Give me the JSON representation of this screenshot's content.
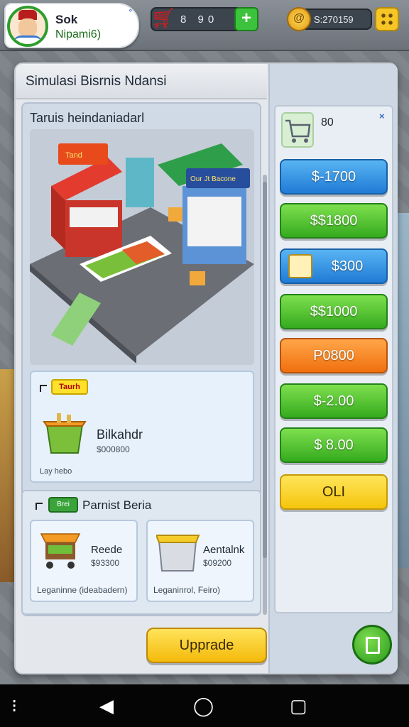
{
  "player": {
    "name": "Sok",
    "subtitle": "Nipami6)",
    "tag": "°"
  },
  "topbar": {
    "cart_value": "8  90",
    "coin_value": "S:270159",
    "coin_symbol": "@"
  },
  "dialog": {
    "title": "Simulasi Bisrnis Ndansi",
    "close_label": "×",
    "section_title": "Taruis heindaniadarl"
  },
  "store_sign": {
    "left": "Tand",
    "right": "Our Jt Bacone"
  },
  "item": {
    "badge": "Taurh",
    "name": "Bilkahdr",
    "price": "$000800",
    "footer": "Lay hebo"
  },
  "partners": {
    "badge": "Brei",
    "title": "Parnist Beria",
    "cards": [
      {
        "name": "Reede",
        "price": "$93300",
        "footer": "Leganinne (ideabadern)"
      },
      {
        "name": "Aentalnk",
        "price": "$09200",
        "footer": "Leganinrol, Feiro)"
      }
    ]
  },
  "shop": {
    "cart_label": "80",
    "close_label": "×",
    "buttons": [
      {
        "label": "$-1700",
        "color": "blue"
      },
      {
        "label": "$$1800",
        "color": "green"
      },
      {
        "label": "$300",
        "color": "blue"
      },
      {
        "label": "$$1000",
        "color": "green"
      },
      {
        "label": "P0800",
        "color": "orange"
      },
      {
        "label": "$-2.00",
        "color": "green"
      },
      {
        "label": "$  8.00",
        "color": "green"
      },
      {
        "label": "OLI",
        "color": "yellow"
      }
    ]
  },
  "footer": {
    "upgrade_label": "Upprade"
  },
  "colors": {
    "accent_blue": "#1f7bd5",
    "accent_green": "#35aa1e",
    "accent_orange": "#f0700d",
    "accent_yellow": "#f5c50d"
  },
  "nav": {
    "menu_icon": "⁝",
    "back_icon": "◀",
    "home_icon": "◯",
    "recents_icon": "▢"
  }
}
